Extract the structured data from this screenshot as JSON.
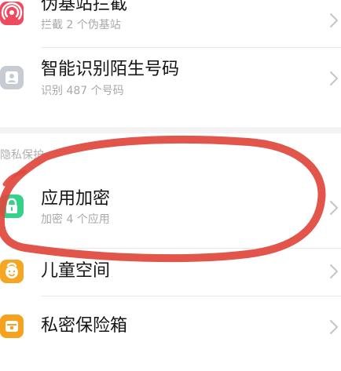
{
  "rows": [
    {
      "title": "伪基站拦截",
      "subtitle": "拦截 2 个伪基站",
      "icon": "radar-signal-icon",
      "color": "#ef4b5f"
    },
    {
      "title": "智能识别陌生号码",
      "subtitle": "识别 487 个号码",
      "icon": "contact-card-icon",
      "color": "#c7cbd3"
    },
    {
      "title": "应用加密",
      "subtitle": "加密 4 个应用",
      "icon": "lock-icon",
      "color": "#36d18a"
    },
    {
      "title": "儿童空间",
      "icon": "child-face-icon",
      "color": "#f5a623"
    },
    {
      "title": "私密保险箱",
      "icon": "safe-box-icon",
      "color": "#f6a21f"
    }
  ],
  "section": {
    "title": "隐私保护"
  },
  "annotation": {
    "color": "#e0483d"
  }
}
